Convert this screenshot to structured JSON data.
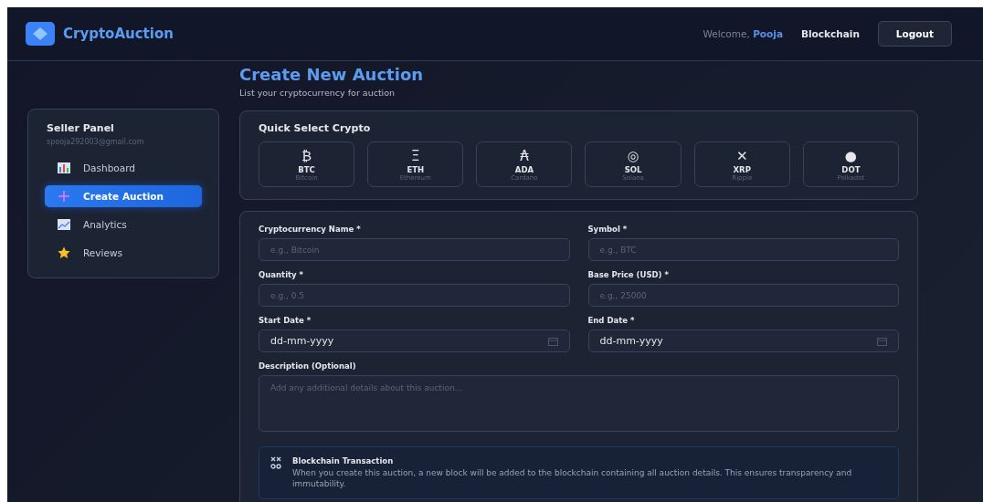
{
  "header": {
    "logo_text": "CryptoAuction",
    "welcome": "Welcome,",
    "user_name": "Pooja",
    "nav_link": "Blockchain",
    "logout": "Logout"
  },
  "page": {
    "title": "Create New Auction",
    "subtitle": "List your cryptocurrency for auction"
  },
  "sidebar": {
    "title": "Seller Panel",
    "email": "spooja292003@gmail.com",
    "items": [
      {
        "label": "Dashboard",
        "selected": false
      },
      {
        "label": "Create Auction",
        "selected": true
      },
      {
        "label": "Analytics",
        "selected": false
      },
      {
        "label": "Reviews",
        "selected": false
      }
    ]
  },
  "quick_select": {
    "title": "Quick Select Crypto",
    "cryptos": [
      {
        "glyph": "₿",
        "symbol": "BTC",
        "name": "Bitcoin"
      },
      {
        "glyph": "Ξ",
        "symbol": "ETH",
        "name": "Ethereum"
      },
      {
        "glyph": "₳",
        "symbol": "ADA",
        "name": "Cardano"
      },
      {
        "glyph": "◎",
        "symbol": "SOL",
        "name": "Solana"
      },
      {
        "glyph": "✕",
        "symbol": "XRP",
        "name": "Ripple"
      },
      {
        "glyph": "●",
        "symbol": "DOT",
        "name": "Polkadot"
      }
    ]
  },
  "form": {
    "fields": [
      {
        "kind": "text",
        "label": "Cryptocurrency Name *",
        "placeholder": "e.g., Bitcoin"
      },
      {
        "kind": "text",
        "label": "Symbol *",
        "placeholder": "e.g., BTC"
      },
      {
        "kind": "text",
        "label": "Quantity *",
        "placeholder": "e.g., 0.5"
      },
      {
        "kind": "text",
        "label": "Base Price (USD) *",
        "placeholder": "e.g., 25000"
      },
      {
        "kind": "date",
        "label": "Start Date *",
        "value": "dd-mm-yyyy"
      },
      {
        "kind": "date",
        "label": "End Date *",
        "value": "dd-mm-yyyy"
      },
      {
        "kind": "textarea",
        "label": "Description (Optional)",
        "placeholder": "Add any additional details about this auction..."
      }
    ],
    "info": {
      "title": "Blockchain Transaction",
      "text": "When you create this auction, a new block will be added to the blockchain containing all auction details. This ensures transparency and immutability."
    }
  }
}
